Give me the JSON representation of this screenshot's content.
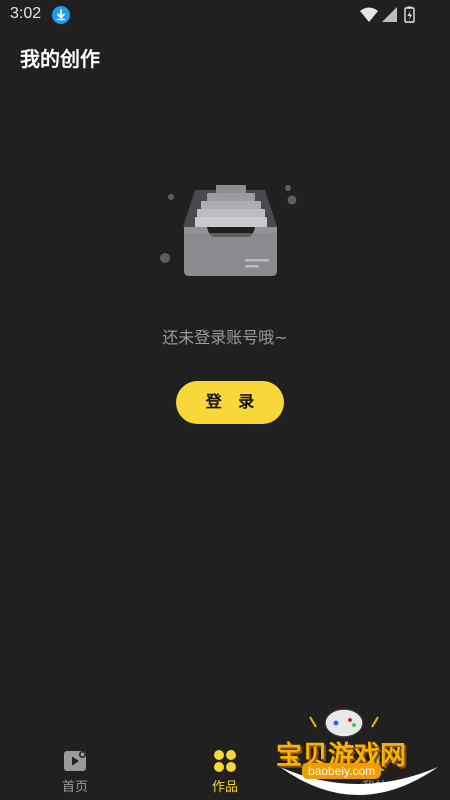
{
  "status_bar": {
    "time": "3:02",
    "icons": [
      "download-icon",
      "wifi-icon",
      "signal-icon",
      "battery-icon"
    ]
  },
  "header": {
    "title": "我的创作"
  },
  "empty_state": {
    "message": "还未登录账号哦~",
    "illustration_icon": "empty-inbox-icon"
  },
  "login_button": {
    "label": "登 录",
    "color": "#f7d73a"
  },
  "bottom_nav": {
    "items": [
      {
        "label": "首页",
        "icon": "video-play-icon",
        "active": false
      },
      {
        "label": "作品",
        "icon": "four-leaf-grid-icon",
        "active": true
      },
      {
        "label": "我的",
        "icon": "profile-icon",
        "active": false
      }
    ],
    "active_color": "#f7d73a"
  },
  "watermark": {
    "title": "宝贝游戏网",
    "url": "baobeiy.com"
  }
}
